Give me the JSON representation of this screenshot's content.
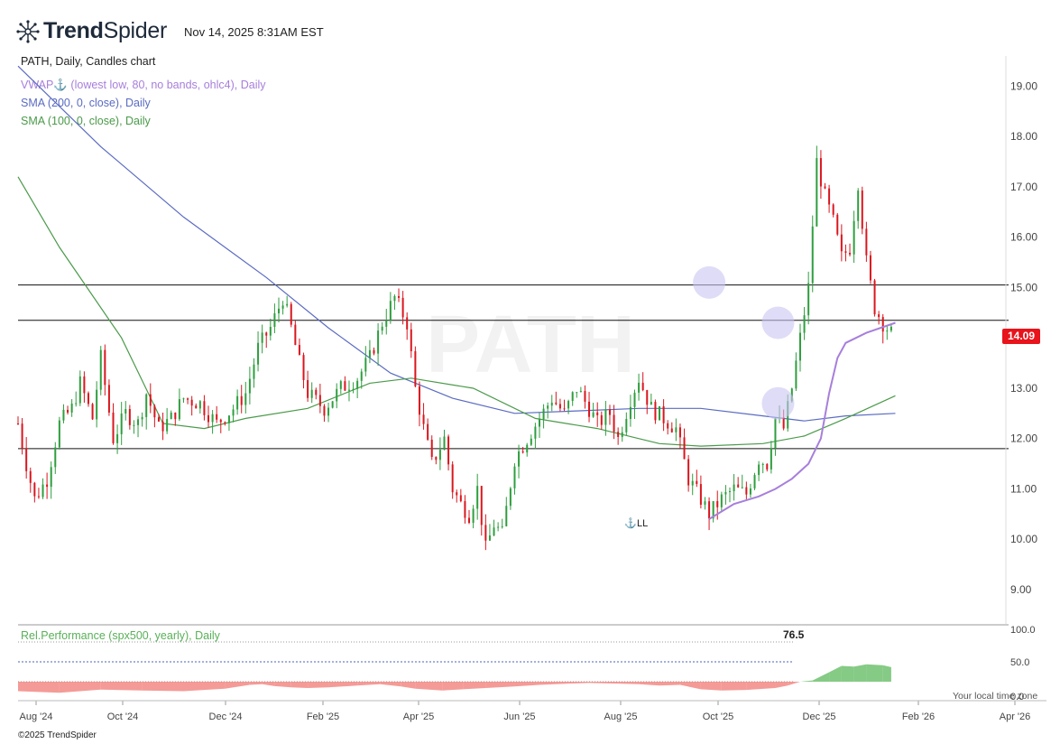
{
  "header": {
    "brand_bold": "Trend",
    "brand_light": "Spider",
    "timestamp": "Nov 14, 2025 8:31AM EST"
  },
  "chart_data": {
    "type": "candlestick",
    "title": "PATH, Daily, Candles chart",
    "watermark": "PATH",
    "indicators": [
      {
        "name": "VWAP",
        "params": "(lowest low, 80, no bands, ohlc4), Daily",
        "color": "#a77fdb"
      },
      {
        "name": "SMA (200, 0, close), Daily",
        "color": "#5a6bc2"
      },
      {
        "name": "SMA (100, 0, close), Daily",
        "color": "#4a9a4a"
      }
    ],
    "y_axis": {
      "ticks": [
        "19.00",
        "18.00",
        "17.00",
        "16.00",
        "15.00",
        "14.00",
        "13.00",
        "12.00",
        "11.00",
        "10.00",
        "9.00"
      ],
      "range": [
        8.3,
        19.6
      ]
    },
    "x_axis": {
      "ticks": [
        "Aug '24",
        "Oct '24",
        "Dec '24",
        "Feb '25",
        "Apr '25",
        "Jun '25",
        "Aug '25",
        "Oct '25",
        "Dec '25",
        "Feb '26",
        "Apr '26"
      ]
    },
    "last_price": "14.09",
    "horizontal_levels": [
      15.05,
      14.35,
      11.8
    ],
    "highlight_circles": [
      {
        "date_frac": 0.652,
        "price": 15.1
      },
      {
        "date_frac": 0.717,
        "price": 14.3
      },
      {
        "date_frac": 0.717,
        "price": 12.7
      }
    ],
    "pivot_label": "LL",
    "price_series": [
      [
        0,
        12.3
      ],
      [
        4,
        11.5
      ],
      [
        8,
        10.8
      ],
      [
        14,
        11.2
      ],
      [
        20,
        12.3
      ],
      [
        26,
        12.6
      ],
      [
        30,
        13.1
      ],
      [
        36,
        12.4
      ],
      [
        40,
        13.6
      ],
      [
        46,
        12.0
      ],
      [
        52,
        12.5
      ],
      [
        58,
        12.3
      ],
      [
        62,
        12.9
      ],
      [
        68,
        12.2
      ],
      [
        74,
        12.4
      ],
      [
        80,
        12.8
      ],
      [
        88,
        12.7
      ],
      [
        96,
        12.3
      ],
      [
        104,
        12.6
      ],
      [
        110,
        12.9
      ],
      [
        116,
        13.8
      ],
      [
        122,
        14.2
      ],
      [
        128,
        14.8
      ],
      [
        132,
        14.2
      ],
      [
        136,
        13.5
      ],
      [
        140,
        12.9
      ],
      [
        148,
        12.6
      ],
      [
        156,
        13.0
      ],
      [
        164,
        13.2
      ],
      [
        170,
        13.6
      ],
      [
        176,
        14.3
      ],
      [
        182,
        14.8
      ],
      [
        188,
        14.3
      ],
      [
        192,
        13.0
      ],
      [
        196,
        12.2
      ],
      [
        200,
        11.5
      ],
      [
        206,
        12.0
      ],
      [
        210,
        11.0
      ],
      [
        214,
        10.7
      ],
      [
        218,
        10.5
      ],
      [
        222,
        11.0
      ],
      [
        226,
        9.8
      ],
      [
        230,
        10.3
      ],
      [
        234,
        10.1
      ],
      [
        240,
        11.6
      ],
      [
        246,
        12.0
      ],
      [
        252,
        12.4
      ],
      [
        258,
        12.8
      ],
      [
        264,
        12.5
      ],
      [
        270,
        13.0
      ],
      [
        276,
        12.6
      ],
      [
        280,
        12.3
      ],
      [
        286,
        12.5
      ],
      [
        290,
        12.0
      ],
      [
        296,
        12.8
      ],
      [
        300,
        13.2
      ],
      [
        306,
        12.6
      ],
      [
        312,
        12.4
      ],
      [
        318,
        12.2
      ],
      [
        324,
        11.2
      ],
      [
        330,
        10.8
      ],
      [
        334,
        10.5
      ],
      [
        340,
        10.8
      ],
      [
        346,
        11.0
      ],
      [
        352,
        10.9
      ],
      [
        358,
        11.6
      ],
      [
        362,
        11.5
      ],
      [
        366,
        12.4
      ],
      [
        370,
        12.2
      ],
      [
        374,
        13.0
      ],
      [
        378,
        14.0
      ],
      [
        382,
        15.0
      ],
      [
        386,
        17.5
      ],
      [
        390,
        16.8
      ],
      [
        394,
        16.3
      ],
      [
        398,
        15.6
      ],
      [
        402,
        15.8
      ],
      [
        406,
        17.1
      ],
      [
        410,
        15.5
      ],
      [
        414,
        14.6
      ],
      [
        418,
        14.3
      ],
      [
        422,
        14.09
      ]
    ],
    "sma200": [
      [
        0,
        19.4
      ],
      [
        40,
        17.8
      ],
      [
        80,
        16.4
      ],
      [
        120,
        15.2
      ],
      [
        150,
        14.2
      ],
      [
        180,
        13.3
      ],
      [
        210,
        12.8
      ],
      [
        240,
        12.5
      ],
      [
        270,
        12.55
      ],
      [
        300,
        12.6
      ],
      [
        330,
        12.6
      ],
      [
        360,
        12.45
      ],
      [
        380,
        12.35
      ],
      [
        400,
        12.45
      ],
      [
        424,
        12.5
      ]
    ],
    "sma100": [
      [
        0,
        17.2
      ],
      [
        20,
        15.8
      ],
      [
        50,
        14.0
      ],
      [
        70,
        12.3
      ],
      [
        90,
        12.2
      ],
      [
        110,
        12.4
      ],
      [
        140,
        12.6
      ],
      [
        170,
        13.1
      ],
      [
        190,
        13.2
      ],
      [
        220,
        13.0
      ],
      [
        250,
        12.4
      ],
      [
        280,
        12.2
      ],
      [
        310,
        11.9
      ],
      [
        330,
        11.85
      ],
      [
        360,
        11.9
      ],
      [
        380,
        12.05
      ],
      [
        400,
        12.4
      ],
      [
        424,
        12.85
      ]
    ],
    "vwap": [
      [
        334,
        10.4
      ],
      [
        346,
        10.7
      ],
      [
        358,
        10.85
      ],
      [
        366,
        11.0
      ],
      [
        374,
        11.2
      ],
      [
        382,
        11.5
      ],
      [
        388,
        12.0
      ],
      [
        392,
        12.9
      ],
      [
        396,
        13.6
      ],
      [
        400,
        13.9
      ],
      [
        410,
        14.1
      ],
      [
        424,
        14.3
      ]
    ],
    "rel_performance": {
      "label": "Rel.Performance (spx500, yearly), Daily",
      "value": "76.5",
      "y_ticks": [
        "100.0",
        "50.0",
        "0.0"
      ],
      "range": [
        0,
        100
      ],
      "series": [
        [
          0,
          -30
        ],
        [
          20,
          -35
        ],
        [
          40,
          -25
        ],
        [
          60,
          -28
        ],
        [
          80,
          -30
        ],
        [
          100,
          -22
        ],
        [
          112,
          -10
        ],
        [
          118,
          -8
        ],
        [
          124,
          -14
        ],
        [
          132,
          -18
        ],
        [
          140,
          -20
        ],
        [
          150,
          -18
        ],
        [
          164,
          -12
        ],
        [
          175,
          -8
        ],
        [
          185,
          -15
        ],
        [
          192,
          -22
        ],
        [
          205,
          -28
        ],
        [
          215,
          -24
        ],
        [
          226,
          -20
        ],
        [
          240,
          -15
        ],
        [
          252,
          -10
        ],
        [
          266,
          -6
        ],
        [
          276,
          -4
        ],
        [
          290,
          -6
        ],
        [
          300,
          -8
        ],
        [
          310,
          -12
        ],
        [
          320,
          -10
        ],
        [
          330,
          -24
        ],
        [
          340,
          -28
        ],
        [
          352,
          -26
        ],
        [
          366,
          -20
        ],
        [
          372,
          -12
        ],
        [
          378,
          0
        ],
        [
          384,
          4
        ],
        [
          392,
          30
        ],
        [
          398,
          50
        ],
        [
          404,
          48
        ],
        [
          410,
          55
        ],
        [
          418,
          52
        ],
        [
          422,
          46
        ]
      ]
    }
  },
  "footer": {
    "local_time_note": "Your local time zone",
    "copyright": "©2025 TrendSpider"
  }
}
